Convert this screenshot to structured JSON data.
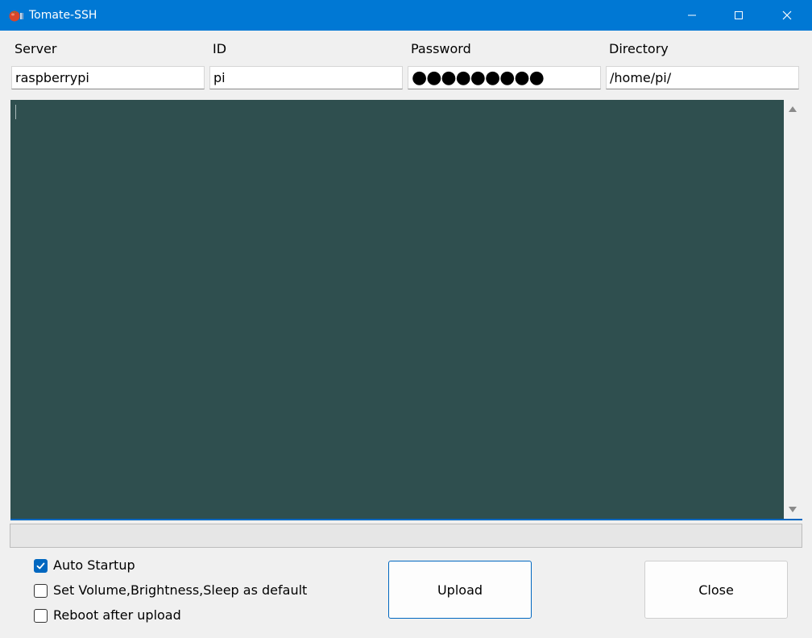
{
  "window": {
    "title": "Tomate-SSH",
    "app_icon": "tomato-icon"
  },
  "fields": [
    {
      "label": "Server",
      "value": "raspberrypi"
    },
    {
      "label": "ID",
      "value": "pi"
    },
    {
      "label": "Password",
      "value": "●●●●●●●●●"
    },
    {
      "label": "Directory",
      "value": "/home/pi/"
    }
  ],
  "console": {
    "text": "",
    "background": "#2f4f4f"
  },
  "progress": {
    "fraction": 0
  },
  "options": [
    {
      "label": "Auto Startup",
      "checked": true
    },
    {
      "label": "Set Volume,Brightness,Sleep as default",
      "checked": false
    },
    {
      "label": "Reboot after upload",
      "checked": false
    }
  ],
  "buttons": {
    "upload": "Upload",
    "close": "Close"
  },
  "colors": {
    "titlebar": "#0078d4",
    "accent": "#0067c0"
  }
}
